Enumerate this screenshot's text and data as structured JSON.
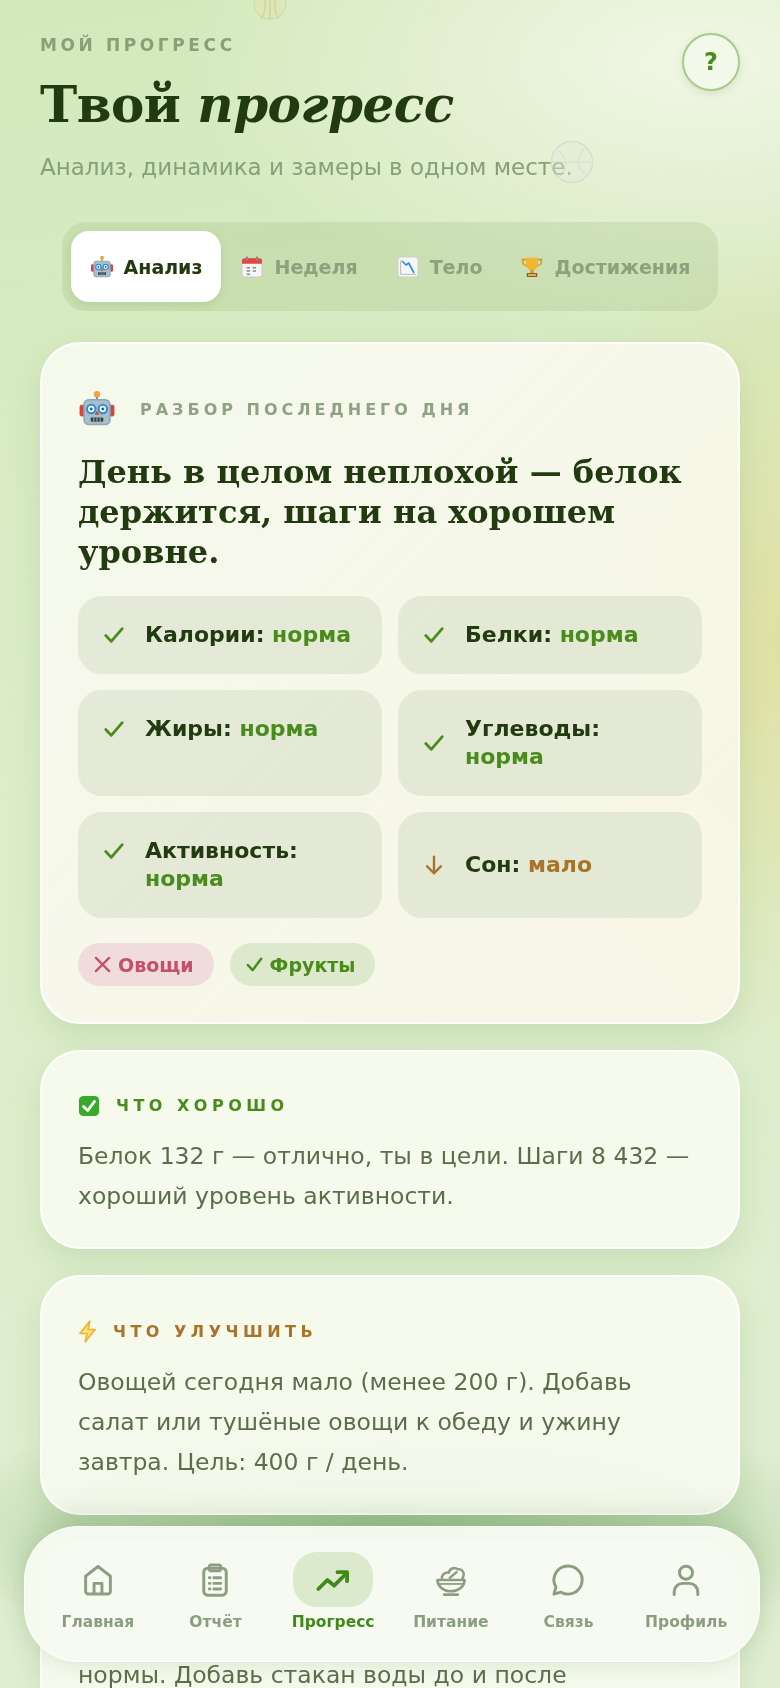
{
  "header": {
    "eyebrow": "МОЙ ПРОГРЕСС",
    "title": "Твой *прогресс*",
    "subtitle": "Анализ, динамика и замеры в одном месте.",
    "help_button": "?"
  },
  "tabs": [
    {
      "label": "Анализ",
      "selected": true
    },
    {
      "label": "Неделя",
      "selected": false
    },
    {
      "label": "Тело",
      "selected": false
    },
    {
      "label": "Достижения",
      "selected": false
    }
  ],
  "analysis": {
    "label": "РАЗБОР ПОСЛЕДНЕГО ДНЯ",
    "headline": "День в целом неплохой — белок держится, шаги на хорошем уровне.",
    "metrics": [
      {
        "label": "Калории:",
        "value": "норма",
        "kind": "ok"
      },
      {
        "label": "Белки:",
        "value": "норма",
        "kind": "ok"
      },
      {
        "label": "Жиры:",
        "value": "норма",
        "kind": "ok"
      },
      {
        "label": "Углеводы:",
        "value": "норма",
        "kind": "ok"
      },
      {
        "label": "Активность:",
        "value": "норма",
        "kind": "ok"
      },
      {
        "label": "Сон:",
        "value": "мало",
        "kind": "low"
      }
    ],
    "tags": [
      {
        "label": "Овощи",
        "kind": "missing"
      },
      {
        "label": "Фрукты",
        "kind": "ok"
      }
    ]
  },
  "insights": [
    {
      "kind": "good",
      "title": "ЧТО ХОРОШО",
      "text": "Белок 132 г — отлично, ты в цели. Шаги 8 432 — хороший уровень активности."
    },
    {
      "kind": "improve",
      "title": "ЧТО УЛУЧШИТЬ",
      "text": "Овощей сегодня мало (менее 200 г). Добавь салат или тушёные овощи к обеду и ужину завтра. Цель: 400 г / день."
    },
    {
      "kind": "partial",
      "text": "нормы. Добавь стакан воды до и после"
    }
  ],
  "nav": [
    {
      "label": "Главная",
      "selected": false
    },
    {
      "label": "Отчёт",
      "selected": false
    },
    {
      "label": "Прогресс",
      "selected": true
    },
    {
      "label": "Питание",
      "selected": false
    },
    {
      "label": "Связь",
      "selected": false
    },
    {
      "label": "Профиль",
      "selected": false
    }
  ]
}
